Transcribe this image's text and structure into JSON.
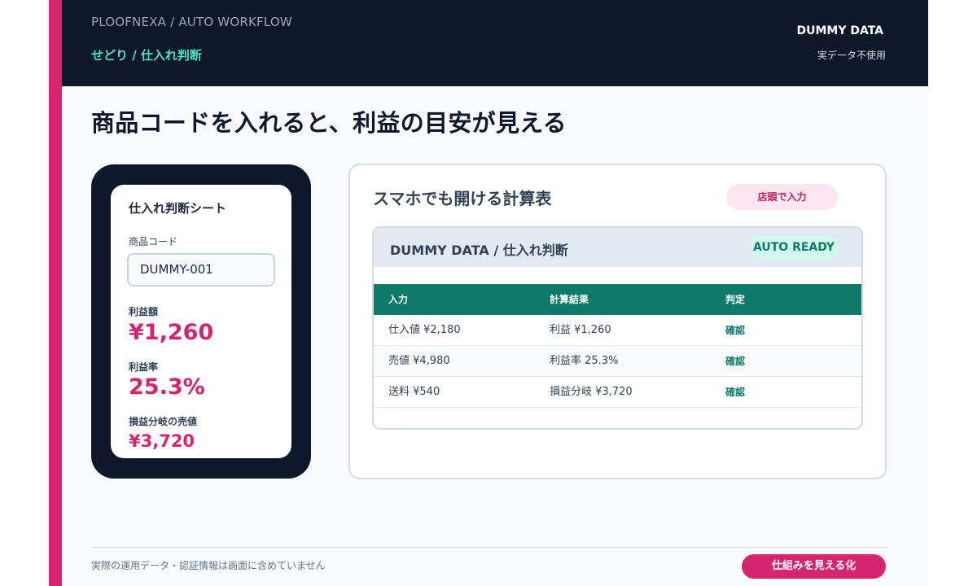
{
  "header": {
    "brand": "PLOOFNEXA / AUTO WORKFLOW",
    "breadcrumb": "せどり / 仕入れ判断",
    "badge_title": "DUMMY DATA",
    "badge_sub": "実データ不使用"
  },
  "headline": "商品コードを入れると、利益の目安が見える",
  "phone": {
    "title": "仕入れ判断シート",
    "code_label": "商品コード",
    "code_value": "DUMMY-001",
    "profit_label": "利益額",
    "profit_value": "¥1,260",
    "rate_label": "利益率",
    "rate_value": "25.3%",
    "breakeven_label": "損益分岐の売値",
    "breakeven_value": "¥3,720"
  },
  "card": {
    "title": "スマホでも開ける計算表",
    "tag": "店頭で入力",
    "sheet_title": "DUMMY DATA / 仕入れ判断",
    "status": "AUTO READY",
    "columns": [
      "入力",
      "計算結果",
      "判定"
    ],
    "rows": [
      [
        "仕入値 ¥2,180",
        "利益 ¥1,260",
        "確認"
      ],
      [
        "売値 ¥4,980",
        "利益率 25.3%",
        "確認"
      ],
      [
        "送料 ¥540",
        "損益分岐 ¥3,720",
        "確認"
      ]
    ]
  },
  "footer": {
    "note": "実際の運用データ・認証情報は画面に含めていません",
    "cta": "仕組みを見える化"
  },
  "colors": {
    "accent": "#d6246e",
    "dark": "#0f172a",
    "teal": "#0e7a6b",
    "mint": "#4ee0c0"
  }
}
